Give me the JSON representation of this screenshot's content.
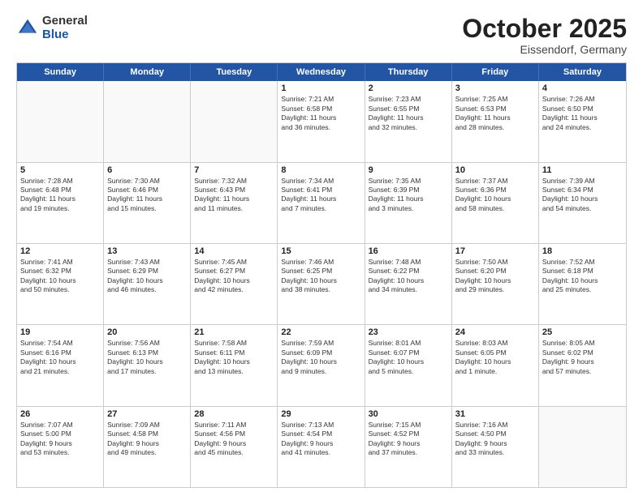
{
  "header": {
    "logo": {
      "general": "General",
      "blue": "Blue"
    },
    "month": "October 2025",
    "location": "Eissendorf, Germany"
  },
  "weekdays": [
    "Sunday",
    "Monday",
    "Tuesday",
    "Wednesday",
    "Thursday",
    "Friday",
    "Saturday"
  ],
  "rows": [
    [
      {
        "day": "",
        "text": "",
        "empty": true
      },
      {
        "day": "",
        "text": "",
        "empty": true
      },
      {
        "day": "",
        "text": "",
        "empty": true
      },
      {
        "day": "1",
        "text": "Sunrise: 7:21 AM\nSunset: 6:58 PM\nDaylight: 11 hours\nand 36 minutes."
      },
      {
        "day": "2",
        "text": "Sunrise: 7:23 AM\nSunset: 6:55 PM\nDaylight: 11 hours\nand 32 minutes."
      },
      {
        "day": "3",
        "text": "Sunrise: 7:25 AM\nSunset: 6:53 PM\nDaylight: 11 hours\nand 28 minutes."
      },
      {
        "day": "4",
        "text": "Sunrise: 7:26 AM\nSunset: 6:50 PM\nDaylight: 11 hours\nand 24 minutes."
      }
    ],
    [
      {
        "day": "5",
        "text": "Sunrise: 7:28 AM\nSunset: 6:48 PM\nDaylight: 11 hours\nand 19 minutes."
      },
      {
        "day": "6",
        "text": "Sunrise: 7:30 AM\nSunset: 6:46 PM\nDaylight: 11 hours\nand 15 minutes."
      },
      {
        "day": "7",
        "text": "Sunrise: 7:32 AM\nSunset: 6:43 PM\nDaylight: 11 hours\nand 11 minutes."
      },
      {
        "day": "8",
        "text": "Sunrise: 7:34 AM\nSunset: 6:41 PM\nDaylight: 11 hours\nand 7 minutes."
      },
      {
        "day": "9",
        "text": "Sunrise: 7:35 AM\nSunset: 6:39 PM\nDaylight: 11 hours\nand 3 minutes."
      },
      {
        "day": "10",
        "text": "Sunrise: 7:37 AM\nSunset: 6:36 PM\nDaylight: 10 hours\nand 58 minutes."
      },
      {
        "day": "11",
        "text": "Sunrise: 7:39 AM\nSunset: 6:34 PM\nDaylight: 10 hours\nand 54 minutes."
      }
    ],
    [
      {
        "day": "12",
        "text": "Sunrise: 7:41 AM\nSunset: 6:32 PM\nDaylight: 10 hours\nand 50 minutes."
      },
      {
        "day": "13",
        "text": "Sunrise: 7:43 AM\nSunset: 6:29 PM\nDaylight: 10 hours\nand 46 minutes."
      },
      {
        "day": "14",
        "text": "Sunrise: 7:45 AM\nSunset: 6:27 PM\nDaylight: 10 hours\nand 42 minutes."
      },
      {
        "day": "15",
        "text": "Sunrise: 7:46 AM\nSunset: 6:25 PM\nDaylight: 10 hours\nand 38 minutes."
      },
      {
        "day": "16",
        "text": "Sunrise: 7:48 AM\nSunset: 6:22 PM\nDaylight: 10 hours\nand 34 minutes."
      },
      {
        "day": "17",
        "text": "Sunrise: 7:50 AM\nSunset: 6:20 PM\nDaylight: 10 hours\nand 29 minutes."
      },
      {
        "day": "18",
        "text": "Sunrise: 7:52 AM\nSunset: 6:18 PM\nDaylight: 10 hours\nand 25 minutes."
      }
    ],
    [
      {
        "day": "19",
        "text": "Sunrise: 7:54 AM\nSunset: 6:16 PM\nDaylight: 10 hours\nand 21 minutes."
      },
      {
        "day": "20",
        "text": "Sunrise: 7:56 AM\nSunset: 6:13 PM\nDaylight: 10 hours\nand 17 minutes."
      },
      {
        "day": "21",
        "text": "Sunrise: 7:58 AM\nSunset: 6:11 PM\nDaylight: 10 hours\nand 13 minutes."
      },
      {
        "day": "22",
        "text": "Sunrise: 7:59 AM\nSunset: 6:09 PM\nDaylight: 10 hours\nand 9 minutes."
      },
      {
        "day": "23",
        "text": "Sunrise: 8:01 AM\nSunset: 6:07 PM\nDaylight: 10 hours\nand 5 minutes."
      },
      {
        "day": "24",
        "text": "Sunrise: 8:03 AM\nSunset: 6:05 PM\nDaylight: 10 hours\nand 1 minute."
      },
      {
        "day": "25",
        "text": "Sunrise: 8:05 AM\nSunset: 6:02 PM\nDaylight: 9 hours\nand 57 minutes."
      }
    ],
    [
      {
        "day": "26",
        "text": "Sunrise: 7:07 AM\nSunset: 5:00 PM\nDaylight: 9 hours\nand 53 minutes."
      },
      {
        "day": "27",
        "text": "Sunrise: 7:09 AM\nSunset: 4:58 PM\nDaylight: 9 hours\nand 49 minutes."
      },
      {
        "day": "28",
        "text": "Sunrise: 7:11 AM\nSunset: 4:56 PM\nDaylight: 9 hours\nand 45 minutes."
      },
      {
        "day": "29",
        "text": "Sunrise: 7:13 AM\nSunset: 4:54 PM\nDaylight: 9 hours\nand 41 minutes."
      },
      {
        "day": "30",
        "text": "Sunrise: 7:15 AM\nSunset: 4:52 PM\nDaylight: 9 hours\nand 37 minutes."
      },
      {
        "day": "31",
        "text": "Sunrise: 7:16 AM\nSunset: 4:50 PM\nDaylight: 9 hours\nand 33 minutes."
      },
      {
        "day": "",
        "text": "",
        "empty": true
      }
    ]
  ]
}
